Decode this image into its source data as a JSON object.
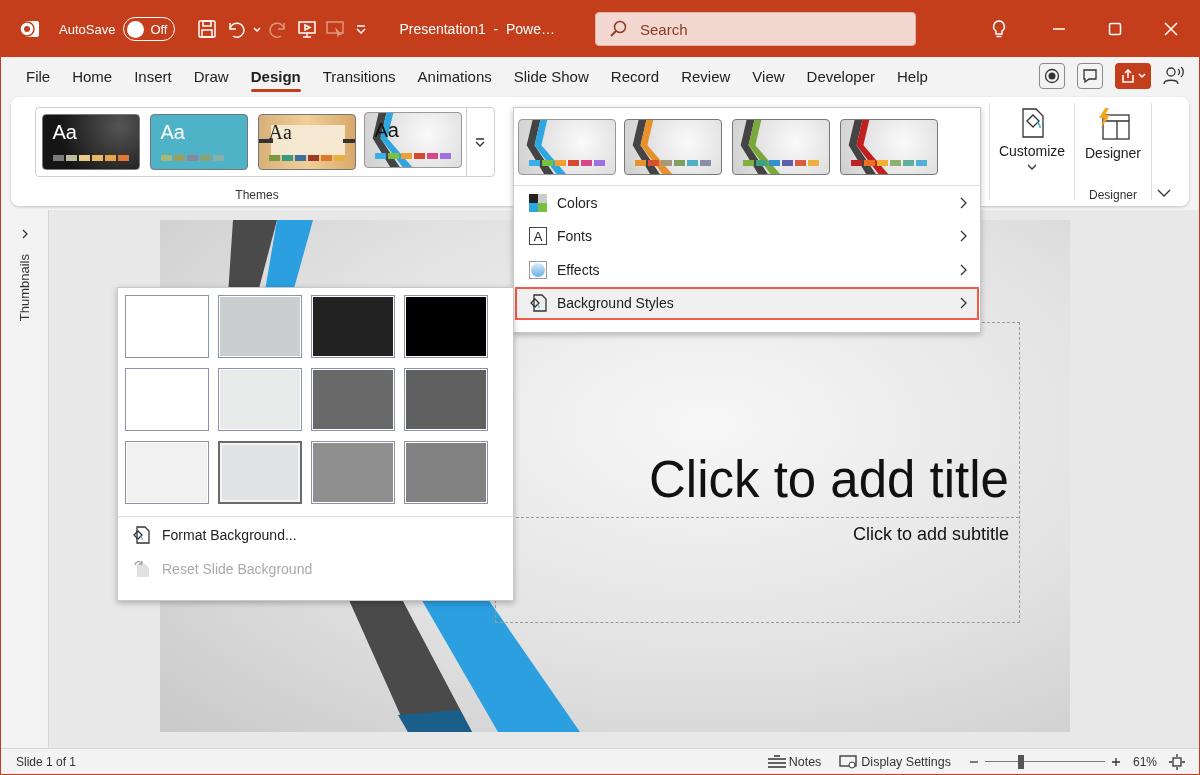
{
  "title_bar": {
    "autosave_label": "AutoSave",
    "autosave": {
      "label": "Off",
      "on": false
    },
    "quick_access": [
      {
        "kind": "save",
        "disabled": false
      },
      {
        "kind": "undo",
        "disabled": false
      },
      {
        "kind": "redo",
        "disabled": true
      },
      {
        "kind": "present",
        "disabled": false
      },
      {
        "kind": "pointer",
        "disabled": true
      }
    ],
    "document_title": "Presentation1  -  Powe…",
    "search": {
      "placeholder": "Search"
    }
  },
  "tabs": [
    {
      "label": "File",
      "selected": false
    },
    {
      "label": "Home",
      "selected": false
    },
    {
      "label": "Insert",
      "selected": false
    },
    {
      "label": "Draw",
      "selected": false
    },
    {
      "label": "Design",
      "selected": true
    },
    {
      "label": "Transitions",
      "selected": false
    },
    {
      "label": "Animations",
      "selected": false
    },
    {
      "label": "Slide Show",
      "selected": false
    },
    {
      "label": "Record",
      "selected": false
    },
    {
      "label": "Review",
      "selected": false
    },
    {
      "label": "View",
      "selected": false
    },
    {
      "label": "Developer",
      "selected": false
    },
    {
      "label": "Help",
      "selected": false
    }
  ],
  "ribbon": {
    "themes": {
      "label": "Themes",
      "items": [
        {
          "kind": "dark",
          "title": "Aa",
          "selected": false,
          "swatches": [
            {
              "color": "#7a7a7a"
            },
            {
              "color": "#b8bc9c"
            },
            {
              "color": "#e8cc88"
            },
            {
              "color": "#e8b868"
            },
            {
              "color": "#e8a448"
            },
            {
              "color": "#e07838"
            }
          ]
        },
        {
          "kind": "teal",
          "title": "Aa",
          "selected": false,
          "swatches": [
            {
              "color": "#a8b87a"
            },
            {
              "color": "#a09c5c"
            },
            {
              "color": "#8a88a0"
            },
            {
              "color": "#90a070"
            },
            {
              "color": "#88b0a8"
            }
          ]
        },
        {
          "kind": "wood",
          "title": "Aa",
          "selected": false,
          "swatches": [
            {
              "color": "#7a9a40"
            },
            {
              "color": "#3a9a80"
            },
            {
              "color": "#3a70a0"
            },
            {
              "color": "#a03a28"
            },
            {
              "color": "#e07828"
            },
            {
              "color": "#e8b040"
            }
          ]
        },
        {
          "kind": "stripes",
          "title": "Aa",
          "selected": true,
          "swatches": [
            {
              "color": "#3ab0e8"
            },
            {
              "color": "#7ac040"
            },
            {
              "color": "#f0a030"
            },
            {
              "color": "#d84830"
            },
            {
              "color": "#d84888"
            },
            {
              "color": "#a070e0"
            }
          ]
        }
      ]
    },
    "customize": {
      "label": "Customize"
    },
    "designer": {
      "label": "Designer",
      "group_label": "Designer"
    }
  },
  "variants_menu": {
    "variants": [
      {
        "color": "#2ea7e0",
        "selected": true,
        "swatches": [
          {
            "color": "#3ab0e8"
          },
          {
            "color": "#7ac040"
          },
          {
            "color": "#f0a030"
          },
          {
            "color": "#d84830"
          },
          {
            "color": "#d84888"
          },
          {
            "color": "#a070e0"
          }
        ]
      },
      {
        "color": "#e8902a",
        "selected": false,
        "swatches": [
          {
            "color": "#e8902a"
          },
          {
            "color": "#d85030"
          },
          {
            "color": "#a89880"
          },
          {
            "color": "#80a060"
          },
          {
            "color": "#50b0c8"
          },
          {
            "color": "#8890a8"
          }
        ]
      },
      {
        "color": "#7aa83a",
        "selected": false,
        "swatches": [
          {
            "color": "#80b040"
          },
          {
            "color": "#40a080"
          },
          {
            "color": "#3090d0"
          },
          {
            "color": "#6060b0"
          },
          {
            "color": "#d86040"
          },
          {
            "color": "#f0b040"
          }
        ]
      },
      {
        "color": "#c02020",
        "selected": false,
        "swatches": [
          {
            "color": "#c02020"
          },
          {
            "color": "#e87020"
          },
          {
            "color": "#f0b030"
          },
          {
            "color": "#90b070"
          },
          {
            "color": "#60b0a0"
          },
          {
            "color": "#50b0d8"
          }
        ]
      }
    ],
    "items": [
      {
        "kind": "colors",
        "label": "Colors",
        "selected": false
      },
      {
        "kind": "fonts",
        "label": "Fonts",
        "glyph": "A",
        "selected": false
      },
      {
        "kind": "effects",
        "label": "Effects",
        "selected": false
      },
      {
        "kind": "background",
        "label": "Background Styles",
        "selected": true
      }
    ]
  },
  "thumbnails_pane": {
    "label": "Thumbnails"
  },
  "slide": {
    "title_placeholder": "Click to add title",
    "subtitle_placeholder": "Click to add subtitle"
  },
  "background_styles": {
    "styles": [
      {
        "color": "#ffffff",
        "selected": false
      },
      {
        "color": "#cbcecf",
        "selected": false
      },
      {
        "color": "#222222",
        "selected": false
      },
      {
        "color": "#000000",
        "selected": false
      },
      {
        "color": "#ffffff",
        "selected": false
      },
      {
        "color": "#e8e9e9",
        "selected": false
      },
      {
        "color": "#696969",
        "selected": false
      },
      {
        "color": "#606060",
        "selected": false
      },
      {
        "color": "#f1f1f1",
        "selected": false
      },
      {
        "color": "#e1e2e3",
        "selected": true
      },
      {
        "color": "#8f8f8f",
        "selected": false
      },
      {
        "color": "#828282",
        "selected": false
      }
    ],
    "items": [
      {
        "kind": "format",
        "label": "Format Background...",
        "disabled": false
      },
      {
        "kind": "reset",
        "label": "Reset Slide Background",
        "disabled": true
      }
    ]
  },
  "status_bar": {
    "slide_info": "Slide 1 of 1",
    "notes": "Notes",
    "display_settings": "Display Settings",
    "zoom": {
      "level": 0.3,
      "reading": "61%"
    }
  }
}
